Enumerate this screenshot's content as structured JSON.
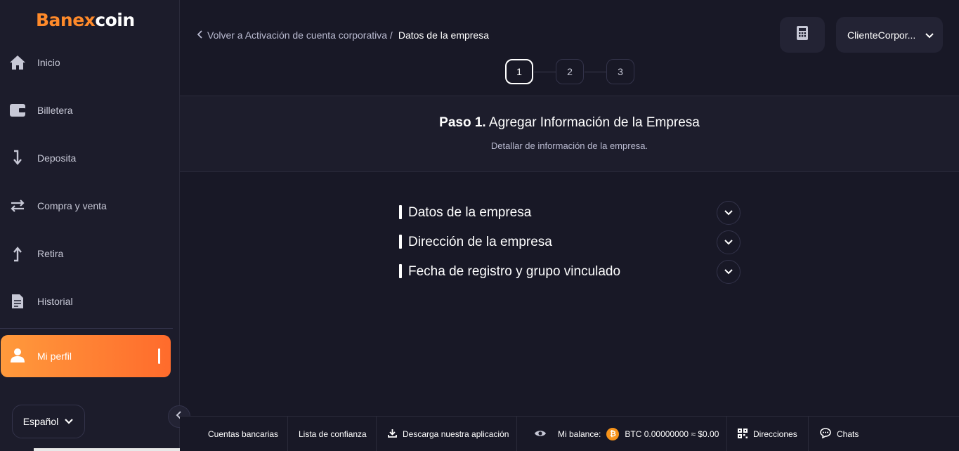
{
  "brand": {
    "part1": "Banex",
    "part2": "coin",
    "accent": "#ff8a2a"
  },
  "sidebar": {
    "items": [
      {
        "label": "Inicio",
        "icon": "home-icon"
      },
      {
        "label": "Billetera",
        "icon": "wallet-icon"
      },
      {
        "label": "Deposita",
        "icon": "arrow-down-icon"
      },
      {
        "label": "Compra y venta",
        "icon": "swap-icon"
      },
      {
        "label": "Retira",
        "icon": "arrow-up-icon"
      },
      {
        "label": "Historial",
        "icon": "document-icon"
      }
    ],
    "active": {
      "label": "Mi perfil",
      "icon": "user-icon"
    },
    "language": "Español"
  },
  "header": {
    "back_label": "Volver a Activación de cuenta corporativa /",
    "current_label": "Datos de la empresa",
    "user_name": "ClienteCorpor..."
  },
  "stepper": {
    "steps": [
      "1",
      "2",
      "3"
    ],
    "active": 1
  },
  "banner": {
    "title_bold": "Paso 1.",
    "title_rest": "Agregar Información de la Empresa",
    "subtitle": "Detallar de información de la empresa."
  },
  "sections": [
    {
      "label": "Datos de la empresa"
    },
    {
      "label": "Dirección de la empresa"
    },
    {
      "label": "Fecha de registro y grupo vinculado"
    }
  ],
  "footer": {
    "bank_accounts": "Cuentas bancarias",
    "trust_list": "Lista de confianza",
    "download_app": "Descarga nuestra aplicación",
    "balance_label": "Mi balance:",
    "balance_value": "BTC 0.00000000 ≈ $0.00",
    "addresses": "Direcciones",
    "chats": "Chats"
  }
}
